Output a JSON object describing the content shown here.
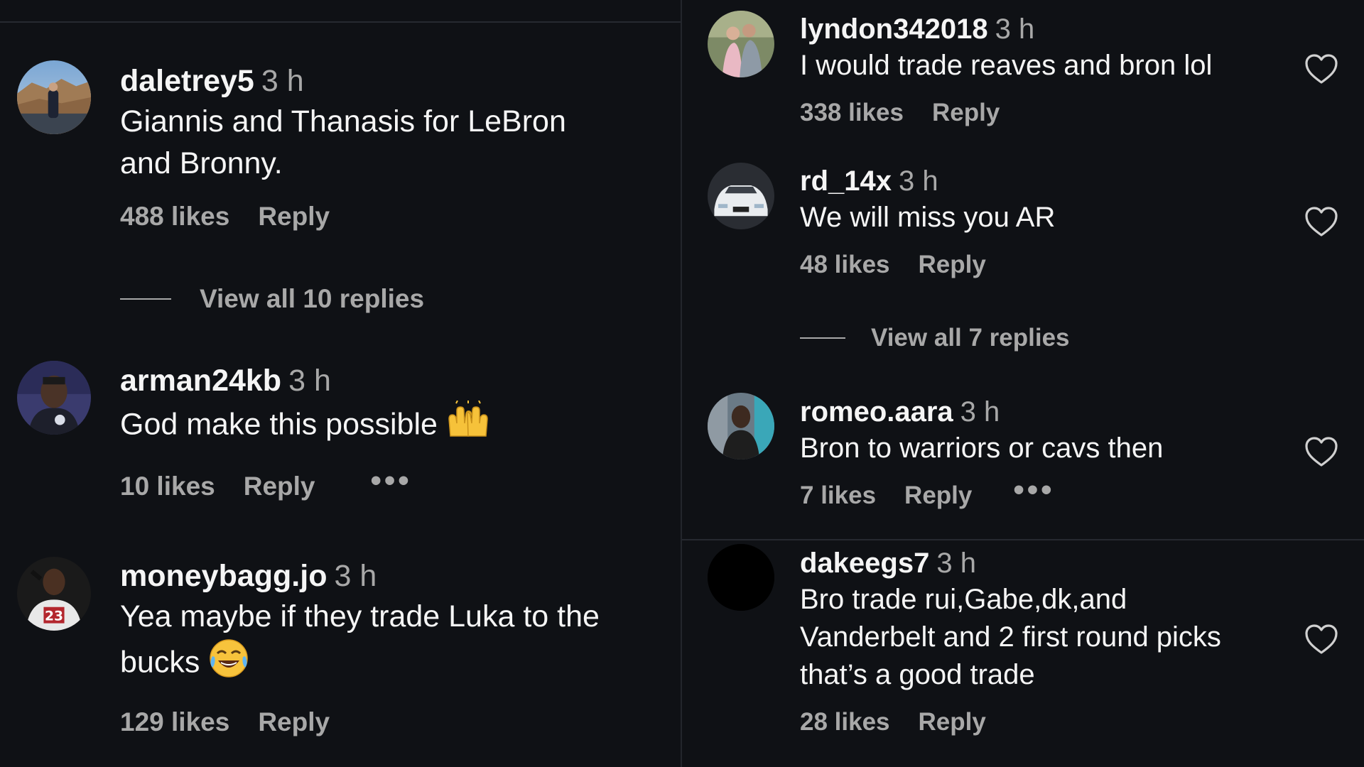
{
  "colors": {
    "background": "#0f1115",
    "primary_text": "#f5f5f5",
    "secondary_text": "#a8a8a8",
    "divider": "#23262c"
  },
  "left_column": {
    "comments": [
      {
        "username": "daletrey5",
        "time": "3 h",
        "text_line1": "Giannis and Thanasis for LeBron",
        "text_line2": "and Bronny.",
        "likes": "488 likes",
        "reply_label": "Reply",
        "view_replies": "View all 10 replies",
        "avatar": "landscape-photo-avatar"
      },
      {
        "username": "arman24kb",
        "time": "3 h",
        "text": "God make this possible",
        "emoji": "raising-hands-emoji",
        "likes": "10 likes",
        "reply_label": "Reply",
        "more_label": "•••",
        "avatar": "person-photo-avatar"
      },
      {
        "username": "moneybagg.jo",
        "time": "3 h",
        "text_line1": "Yea maybe if they trade Luka to the",
        "text_line2": "bucks",
        "emoji": "tears-of-joy-emoji",
        "likes": "129 likes",
        "reply_label": "Reply",
        "avatar": "jersey-23-photo-avatar"
      }
    ]
  },
  "right_column": {
    "comments": [
      {
        "username": "lyndon342018",
        "time": "3 h",
        "text": "I would trade reaves and bron lol",
        "likes": "338 likes",
        "reply_label": "Reply",
        "avatar": "couple-photo-avatar",
        "like_icon": "heart-outline-icon"
      },
      {
        "username": "rd_14x",
        "time": "3 h",
        "text": "We will miss you AR",
        "likes": "48 likes",
        "reply_label": "Reply",
        "view_replies": "View all 7 replies",
        "avatar": "white-car-photo-avatar",
        "like_icon": "heart-outline-icon"
      },
      {
        "username": "romeo.aara",
        "time": "3 h",
        "text": "Bron to warriors or cavs then",
        "likes": "7 likes",
        "reply_label": "Reply",
        "more_label": "•••",
        "avatar": "person-photo-avatar",
        "like_icon": "heart-outline-icon"
      },
      {
        "username": "dakeegs7",
        "time": "3 h",
        "text_line1": "Bro trade rui,Gabe,dk,and",
        "text_line2": "Vanderbelt and 2 first round picks",
        "text_line3": "that’s a good trade",
        "likes": "28 likes",
        "reply_label": "Reply",
        "avatar": "black-avatar",
        "like_icon": "heart-outline-icon"
      }
    ]
  }
}
